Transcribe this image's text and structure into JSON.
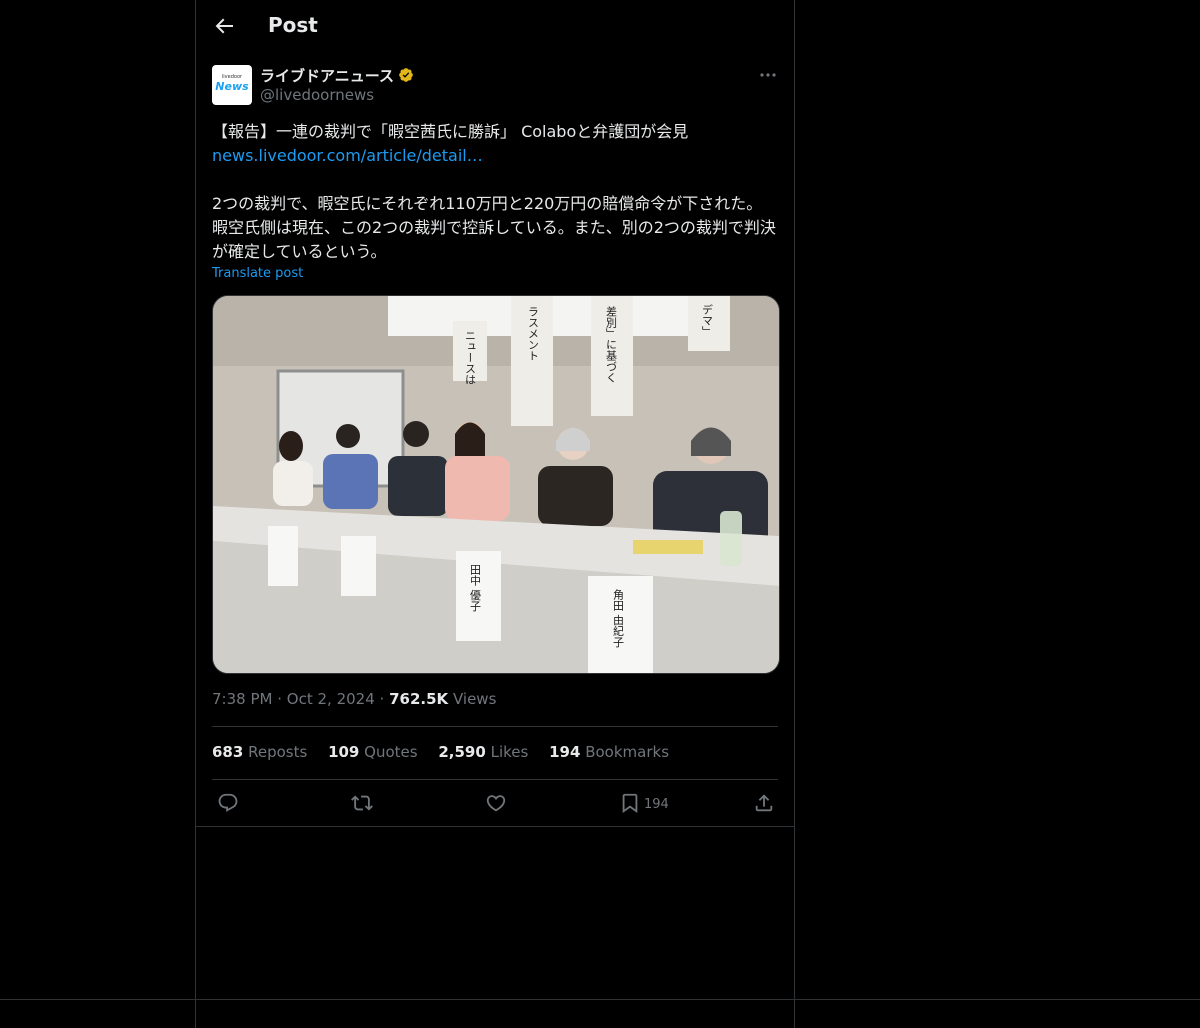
{
  "header": {
    "title": "Post"
  },
  "author": {
    "logo_top": "livedoor",
    "logo_main": "News",
    "name": "ライブドアニュース",
    "handle": "@livedoornews"
  },
  "post": {
    "line1": "【報告】一連の裁判で「暇空茜氏に勝訴」 Colaboと弁護団が会見",
    "link": "news.livedoor.com/article/detail…",
    "paragraph": "2つの裁判で、暇空氏にそれぞれ110万円と220万円の賠償命令が下された。暇空氏側は現在、この2つの裁判で控訴している。また、別の2つの裁判で判決が確定しているという。",
    "translate": "Translate post"
  },
  "photo_text": {
    "sign_a": "ニュースは\n万円支払え",
    "sign_b": "ガル\nラスメント」と 認定",
    "sign_c": "差別」に基づく\n嫌がらせ」目的認定",
    "sign_d": "デマ」\n認定",
    "plate_1": "田中\n優子",
    "plate_2": "角田\n由紀子"
  },
  "meta": {
    "time": "7:38 PM",
    "date": "Oct 2, 2024",
    "views": "762.5K",
    "views_label": "Views",
    "dot": "·"
  },
  "stats": [
    {
      "count": "683",
      "label": "Reposts"
    },
    {
      "count": "109",
      "label": "Quotes"
    },
    {
      "count": "2,590",
      "label": "Likes"
    },
    {
      "count": "194",
      "label": "Bookmarks"
    }
  ],
  "actions": {
    "bookmark_count": "194"
  },
  "colors": {
    "accent": "#1d9bf0",
    "verified": "#e2b719",
    "border": "#2f3336",
    "muted": "#71767b"
  }
}
